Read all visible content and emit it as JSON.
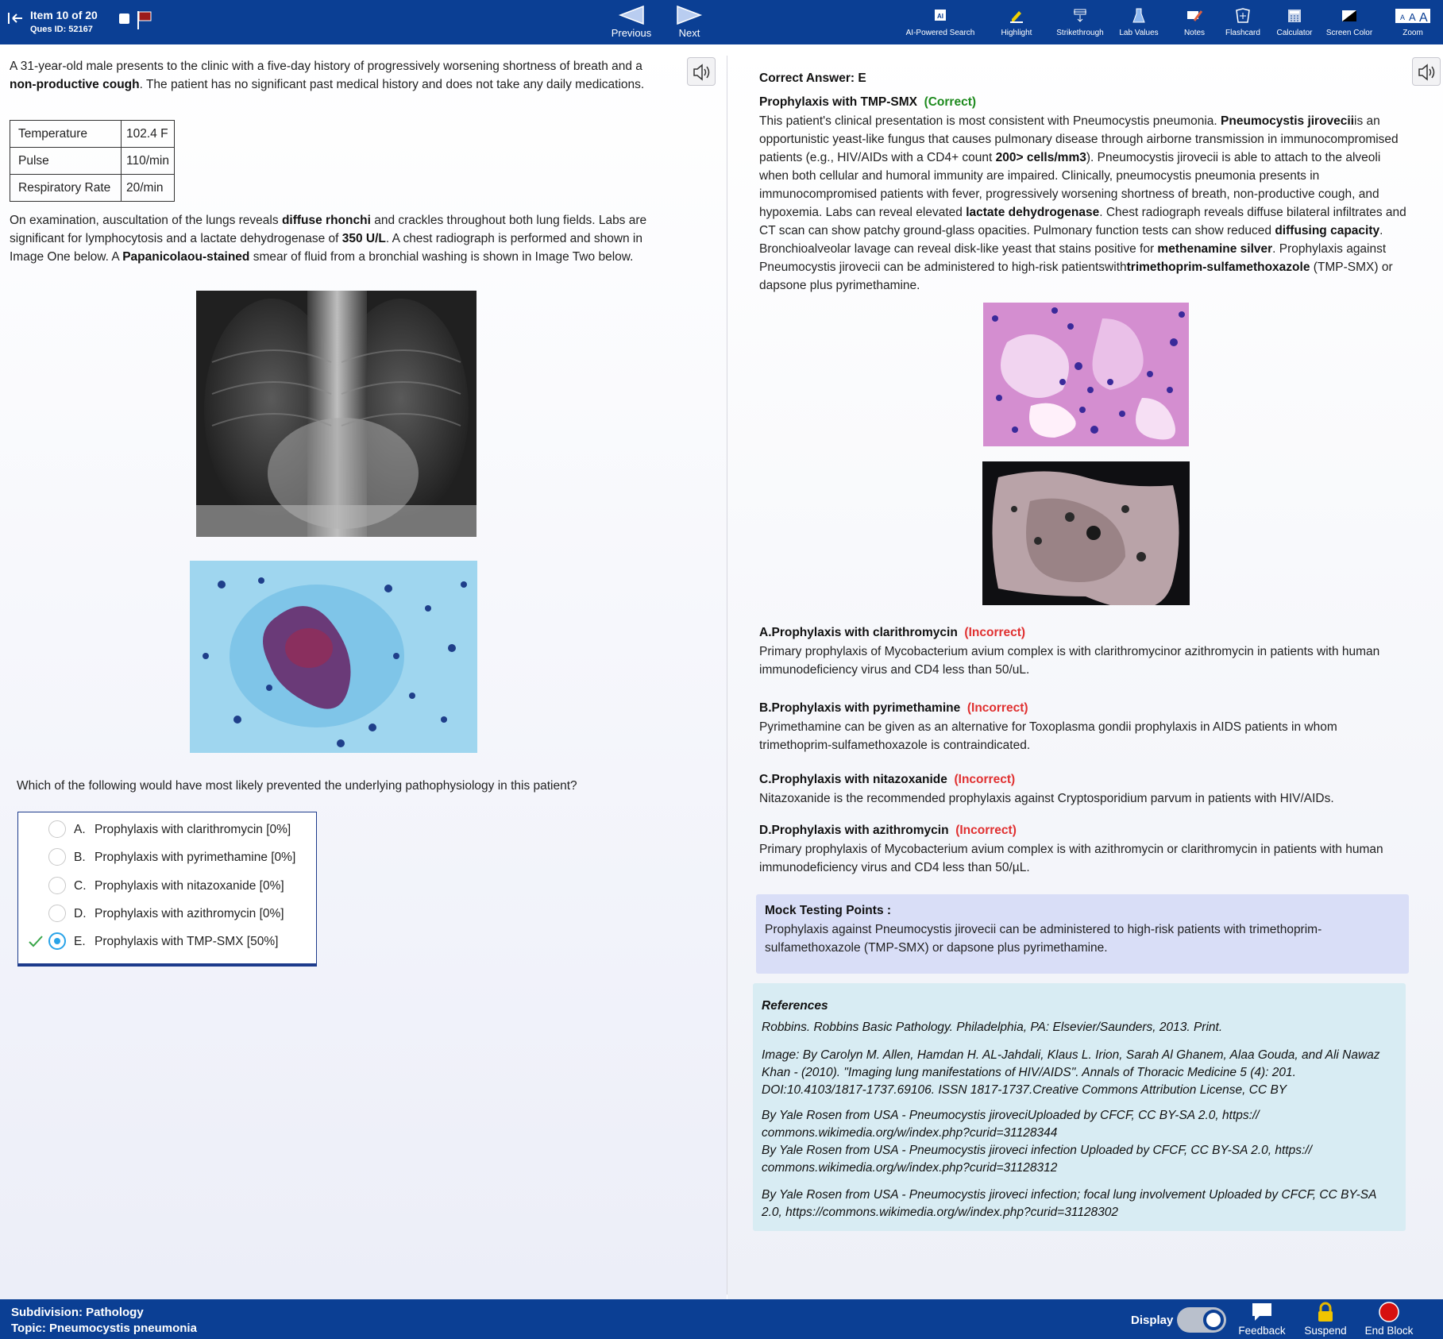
{
  "topbar": {
    "item_title": "Item 10 of 20",
    "ques_id": "Ques ID: 52167",
    "previous": "Previous",
    "next": "Next",
    "tools": [
      {
        "label": "AI-Powered Search",
        "icon": "ai-icon"
      },
      {
        "label": "Highlight",
        "icon": "highlighter-icon"
      },
      {
        "label": "Strikethrough",
        "icon": "strikethrough-icon"
      },
      {
        "label": "Lab Values",
        "icon": "flask-icon"
      },
      {
        "label": "Notes",
        "icon": "notes-icon"
      },
      {
        "label": "Flashcard",
        "icon": "flashcard-icon"
      },
      {
        "label": "Calculator",
        "icon": "calculator-icon"
      },
      {
        "label": "Screen Color",
        "icon": "contrast-icon"
      },
      {
        "label": "Zoom",
        "icon": "zoom-font-icon"
      }
    ],
    "ai_glyph": "AI",
    "zoom_glyphs": [
      "A",
      "A",
      "A"
    ]
  },
  "question": {
    "stem_parts": [
      "A 31-year-old male presents to the clinic with a five-day history of progressively worsening shortness of breath and a ",
      "non-productive cough",
      ". The patient has no significant past medical history and does not take any daily medications."
    ],
    "vitals": [
      {
        "name": "Temperature",
        "value": "102.4 F"
      },
      {
        "name": "Pulse",
        "value": "110/min"
      },
      {
        "name": "Respiratory Rate",
        "value": "20/min"
      }
    ],
    "exam_parts": [
      "On examination, auscultation of the lungs reveals ",
      "diffuse rhonchi",
      " and crackles throughout both lung fields. Labs are significant for lymphocytosis and a lactate dehydrogenase of ",
      "350 U/L",
      ". A chest radiograph is performed and shown in Image One below. A ",
      "Papanicolaou-stained",
      " smear of fluid from a bronchial washing is shown in Image Two below."
    ],
    "prompt": "Which of the following would have most likely prevented the underlying pathophysiology in this patient?",
    "options": [
      {
        "letter": "A.",
        "text": "Prophylaxis with clarithromycin [0%]",
        "selected": false
      },
      {
        "letter": "B.",
        "text": "Prophylaxis with pyrimethamine [0%]",
        "selected": false
      },
      {
        "letter": "C.",
        "text": "Prophylaxis with nitazoxanide [0%]",
        "selected": false
      },
      {
        "letter": "D.",
        "text": "Prophylaxis with azithromycin [0%]",
        "selected": false
      },
      {
        "letter": "E.",
        "text": "Prophylaxis with TMP-SMX [50%]",
        "selected": true
      }
    ]
  },
  "explanation": {
    "correct_answer": "Correct Answer: E",
    "correct_title": "Prophylaxis with TMP-SMX",
    "correct_tag": "(Correct)",
    "body_parts": [
      "This patient's clinical presentation is most consistent with Pneumocystis pneumonia. ",
      "Pneumocystis jirovecii",
      "is an opportunistic yeast-like fungus that causes pulmonary disease through airborne transmission in immunocompromised patients (e.g., HIV/AIDs with a CD4+ count ",
      "200> cells/mm3",
      "). Pneumocystis jirovecii is able to attach to the alveoli when both cellular and humoral immunity are impaired. Clinically, pneumocystis pneumonia presents in immunocompromised patients with fever, progressively worsening shortness of breath, non-productive cough, and hypoxemia. Labs can reveal elevated ",
      "lactate dehydrogenase",
      ". Chest radiograph reveals diffuse bilateral infiltrates and CT scan can show patchy ground-glass opacities. Pulmonary function tests can show reduced ",
      "diffusing capacity",
      ". Bronchioalveolar lavage can reveal disk-like yeast that stains positive for ",
      "methenamine silver",
      ". Prophylaxis against Pneumocystis jirovecii can be administered to high-risk patientswith",
      "trimethoprim-sulfamethoxazole",
      " (TMP-SMX) or dapsone plus pyrimethamine."
    ],
    "wrong": [
      {
        "title": "A.Prophylaxis with clarithromycin",
        "tag": "(Incorrect)",
        "text": "Primary prophylaxis of Mycobacterium avium complex is with clarithromycinor azithromycin in patients with human immunodeficiency virus and CD4 less than 50/uL."
      },
      {
        "title": "B.Prophylaxis with pyrimethamine",
        "tag": "(Incorrect)",
        "text": "Pyrimethamine can be given as an alternative for Toxoplasma gondii prophylaxis in AIDS patients in whom trimethoprim-sulfamethoxazole is contraindicated."
      },
      {
        "title": "C.Prophylaxis with nitazoxanide",
        "tag": "(Incorrect)",
        "text": "Nitazoxanide is the recommended prophylaxis against Cryptosporidium parvum in patients with HIV/AIDs."
      },
      {
        "title": "D.Prophylaxis with azithromycin",
        "tag": "(Incorrect)",
        "text": "Primary prophylaxis of Mycobacterium avium complex is with azithromycin or clarithromycin in patients with human immunodeficiency virus and CD4 less than 50/µL."
      }
    ],
    "mock_title": "Mock Testing Points :",
    "mock_text": "Prophylaxis against Pneumocystis jirovecii can be administered to high-risk patients with trimethoprim-sulfamethoxazole (TMP-SMX) or dapsone plus pyrimethamine.",
    "refs_title": "References",
    "refs": [
      "Robbins. Robbins Basic Pathology. Philadelphia, PA: Elsevier/Saunders, 2013. Print.",
      "Image: By Carolyn M. Allen, Hamdan H. AL-Jahdali, Klaus L. Irion, Sarah Al Ghanem, Alaa Gouda, and Ali Nawaz Khan - (2010). \"Imaging lung manifestations of HIV/AIDS\". Annals of Thoracic Medicine 5 (4): 201. DOI:10.4103/1817-1737.69106. ISSN 1817-1737.Creative Commons Attribution License, CC BY",
      "By Yale Rosen from USA - Pneumocystis jiroveciUploaded by CFCF, CC BY-SA 2.0, https:// commons.wikimedia.org/w/index.php?curid=31128344",
      "By Yale Rosen from USA - Pneumocystis jiroveci infection Uploaded by CFCF, CC BY-SA 2.0, https:// commons.wikimedia.org/w/index.php?curid=31128312",
      "By Yale Rosen from USA - Pneumocystis jiroveci infection; focal lung involvement Uploaded by CFCF, CC BY-SA 2.0, https://commons.wikimedia.org/w/index.php?curid=31128302"
    ]
  },
  "bottombar": {
    "subdivision": "Subdivision: Pathology",
    "topic": "Topic: Pneumocystis pneumonia",
    "display_label": "Display",
    "feedback": "Feedback",
    "suspend": "Suspend",
    "end_block": "End Block"
  },
  "colors": {
    "bar": "#0b3f94",
    "correct": "#1e8a1e",
    "incorrect": "#e03030",
    "selected_radio": "#29a3e8",
    "mock_bg": "#d9def7",
    "refs_bg": "#d8ecf3"
  }
}
